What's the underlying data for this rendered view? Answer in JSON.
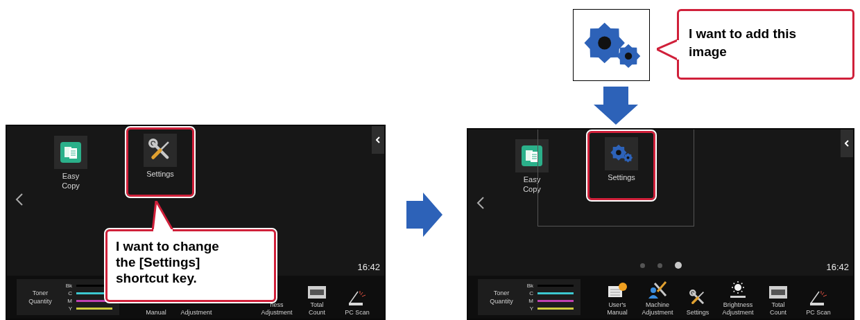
{
  "left_screen": {
    "shortcuts": [
      {
        "kind": "easy_copy",
        "label": "Easy\nCopy",
        "highlighted": false
      },
      {
        "kind": "tools",
        "label": "Settings",
        "highlighted": true
      }
    ],
    "time": "16:42",
    "toner": {
      "label": "Toner\nQuantity",
      "colors": [
        {
          "label": "Bk",
          "color": "#000000"
        },
        {
          "label": "C",
          "color": "#3cc8d0"
        },
        {
          "label": "M",
          "color": "#c040b0"
        },
        {
          "label": "Y",
          "color": "#d0cc40"
        }
      ]
    },
    "bottom_items": [
      {
        "kind": "covered",
        "label": "Manual"
      },
      {
        "kind": "covered",
        "label": "Adjustment"
      },
      {
        "kind": "hidden"
      },
      {
        "kind": "covered",
        "label": "ness\nAdjustment"
      },
      {
        "kind": "counter",
        "label": "Total\nCount"
      },
      {
        "kind": "scanner",
        "label": "PC Scan"
      }
    ],
    "callout": "I want to change the [Settings] shortcut key."
  },
  "new_image": {
    "kind": "gears",
    "callout": "I want to add this image"
  },
  "right_screen": {
    "shortcuts": [
      {
        "kind": "easy_copy",
        "label": "Easy\nCopy",
        "highlighted": false
      },
      {
        "kind": "gears",
        "label": "Settings",
        "highlighted": true
      }
    ],
    "page_dots": [
      {
        "selected": false
      },
      {
        "selected": false
      },
      {
        "selected": true
      }
    ],
    "time": "16:42",
    "toner": {
      "label": "Toner\nQuantity",
      "colors": [
        {
          "label": "Bk",
          "color": "#000000"
        },
        {
          "label": "C",
          "color": "#3cc8d0"
        },
        {
          "label": "M",
          "color": "#c040b0"
        },
        {
          "label": "Y",
          "color": "#d0cc40"
        }
      ]
    },
    "bottom_items": [
      {
        "kind": "manual",
        "label": "User's\nManual"
      },
      {
        "kind": "machine",
        "label": "Machine\nAdjustment"
      },
      {
        "kind": "tools",
        "label": "Settings"
      },
      {
        "kind": "brightness",
        "label": "Brightness\nAdjustment"
      },
      {
        "kind": "counter",
        "label": "Total\nCount"
      },
      {
        "kind": "scanner",
        "label": "PC Scan"
      }
    ]
  }
}
